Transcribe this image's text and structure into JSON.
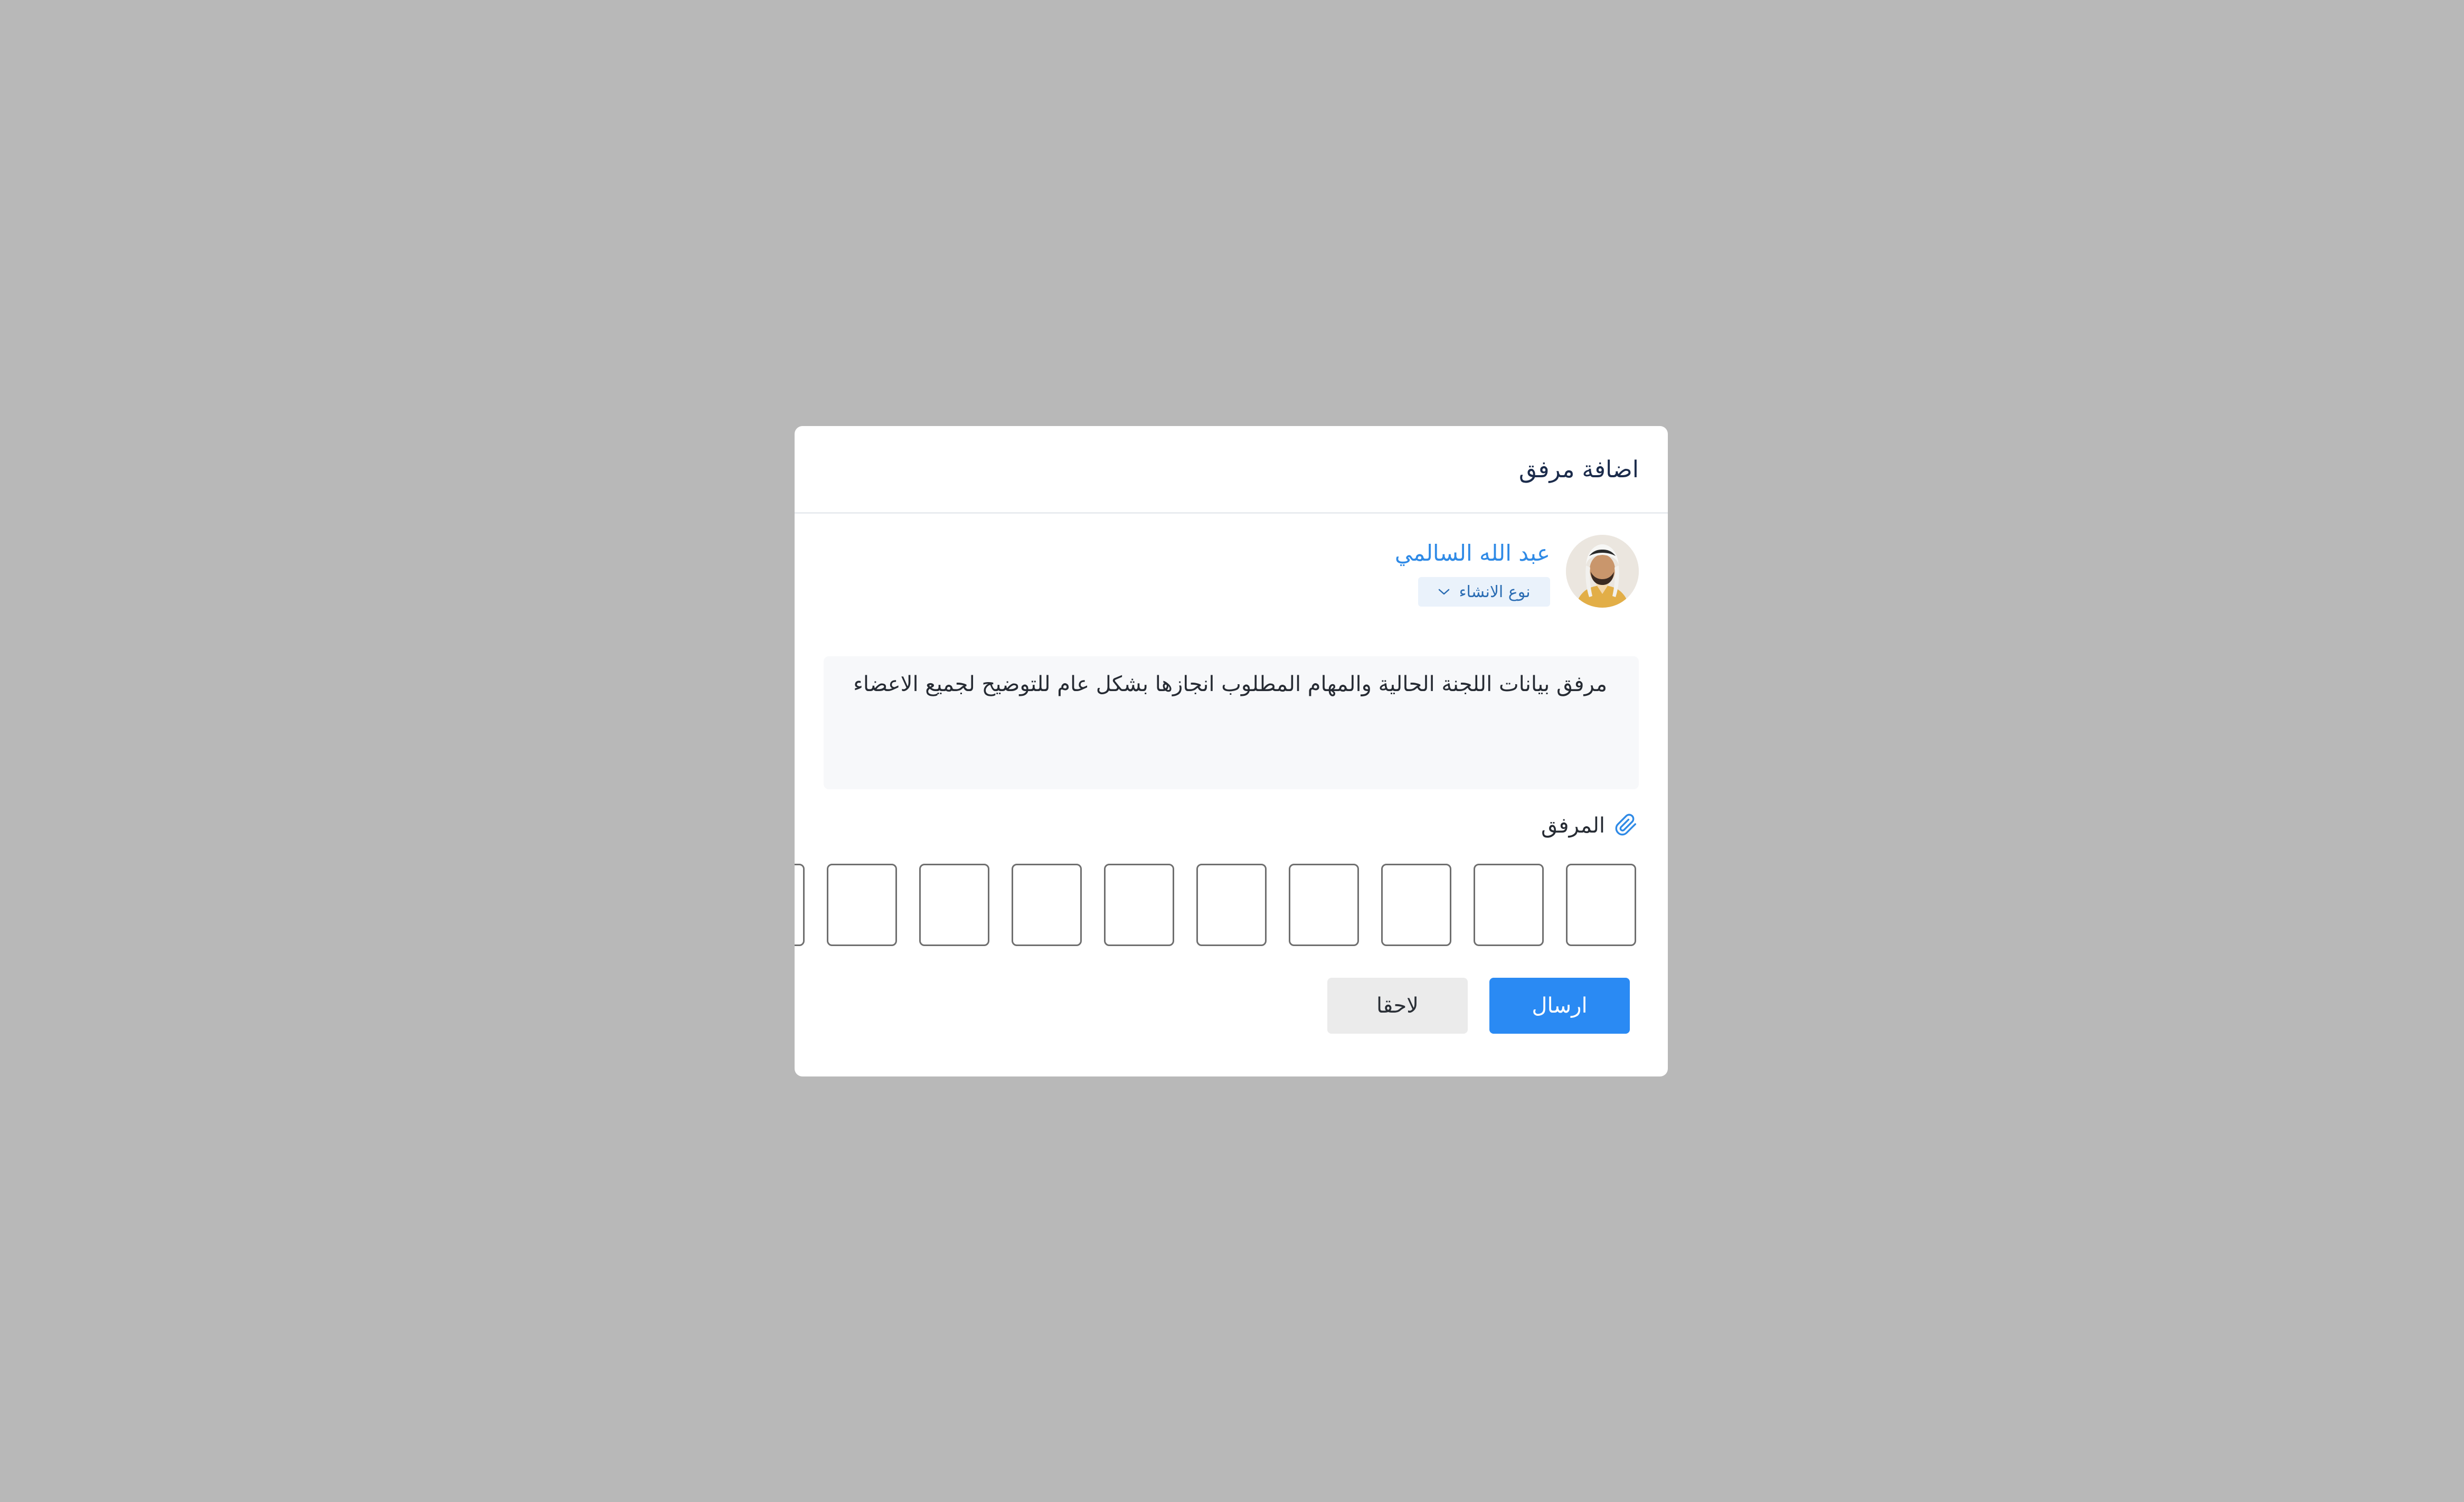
{
  "modal": {
    "title": "اضافة مرفق"
  },
  "user": {
    "name": "عبد الله السالمي",
    "type_chip": "نوع الانشاء",
    "type_chip_icon": "chevron-down-icon",
    "avatar": "user-avatar"
  },
  "note": {
    "text": "مرفق بيانات اللجنة الحالية والمهام المطلوب انجازها بشكل عام للتوضيح لجميع الاعضاء"
  },
  "attachment": {
    "label": "المرفق",
    "icon": "paperclip-icon",
    "slots": 10
  },
  "actions": {
    "send_label": "ارسال",
    "later_label": "لاحقا"
  },
  "colors": {
    "backdrop": "#b8b8b8",
    "primary": "#2a8af3",
    "user_name": "#2f8ae6",
    "chip_bg": "#eaf2fb",
    "secondary_button": "#ebebeb"
  }
}
